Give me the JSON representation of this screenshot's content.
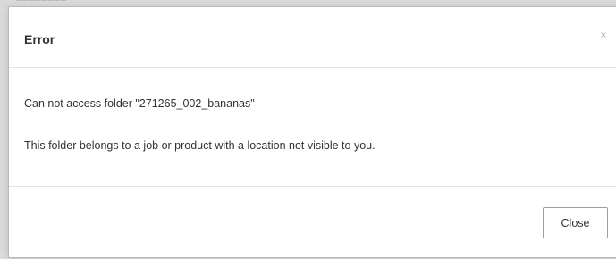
{
  "background": {
    "fragment_text": "‒‒‒‒‒‒‒‒"
  },
  "dialog": {
    "title": "Error",
    "close_icon_glyph": "×",
    "messages": {
      "line1": "Can not access folder \"271265_002_bananas\"",
      "line2": "This folder belongs to a job or product with a location not visible to you."
    },
    "footer": {
      "close_label": "Close"
    }
  },
  "colors": {
    "backdrop": "#d9d9d9",
    "dialog_bg": "#ffffff",
    "text": "#333333",
    "divider": "#e5e5e5",
    "button_border": "#9e9e9e",
    "close_icon": "#b3b3b3"
  }
}
